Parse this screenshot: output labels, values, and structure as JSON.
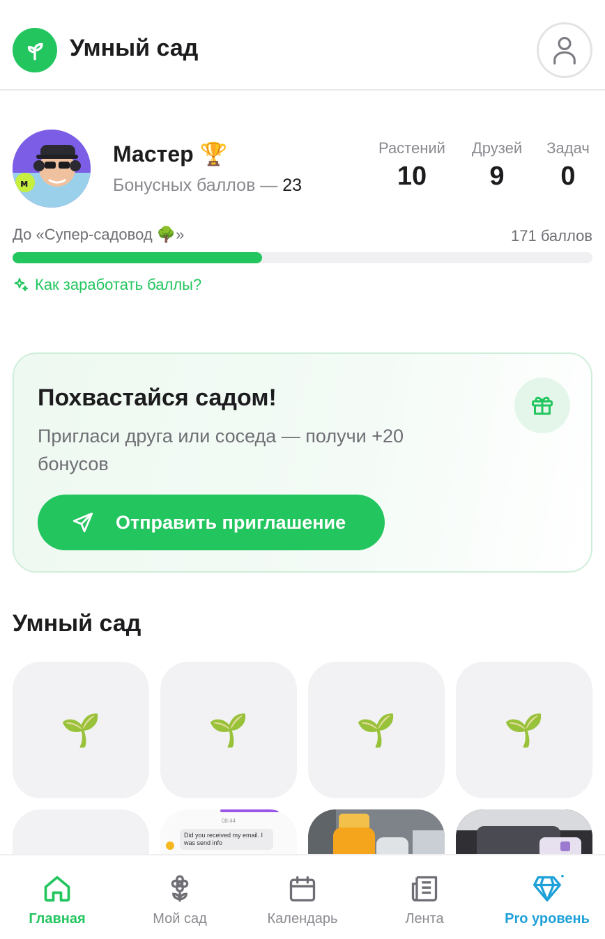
{
  "header": {
    "title": "Умный сад"
  },
  "profile": {
    "rank": "Мастер 🏆",
    "bonus_label": "Бонусных баллов —",
    "bonus_value": "23",
    "stats": [
      {
        "label": "Растений",
        "value": "10"
      },
      {
        "label": "Друзей",
        "value": "9"
      },
      {
        "label": "Задач",
        "value": "0"
      }
    ],
    "progress": {
      "label": "До «Супер-садовод 🌳»",
      "remaining": "171 баллов",
      "fraction": 0.43
    },
    "earn_link": "Как заработать баллы?"
  },
  "invite": {
    "title": "Похвастайся садом!",
    "description": "Пригласи друга или соседа — получи +20 бонусов",
    "button": "Отправить приглашение"
  },
  "garden": {
    "title": "Умный сад",
    "sprout": "🌱",
    "chat_time": "08:44",
    "chat_text": "Did you received my email. I was send info"
  },
  "nav": {
    "items": [
      {
        "label": "Главная",
        "icon": "home-icon",
        "active": true
      },
      {
        "label": "Мой сад",
        "icon": "flower-icon"
      },
      {
        "label": "Календарь",
        "icon": "calendar-icon"
      },
      {
        "label": "Лента",
        "icon": "news-icon"
      },
      {
        "label": "Pro уровень",
        "icon": "diamond-icon"
      }
    ]
  },
  "colors": {
    "accent": "#22c55e",
    "pro": "#1ea0d8",
    "text": "#1c1c1e",
    "muted": "#8a8a90"
  }
}
